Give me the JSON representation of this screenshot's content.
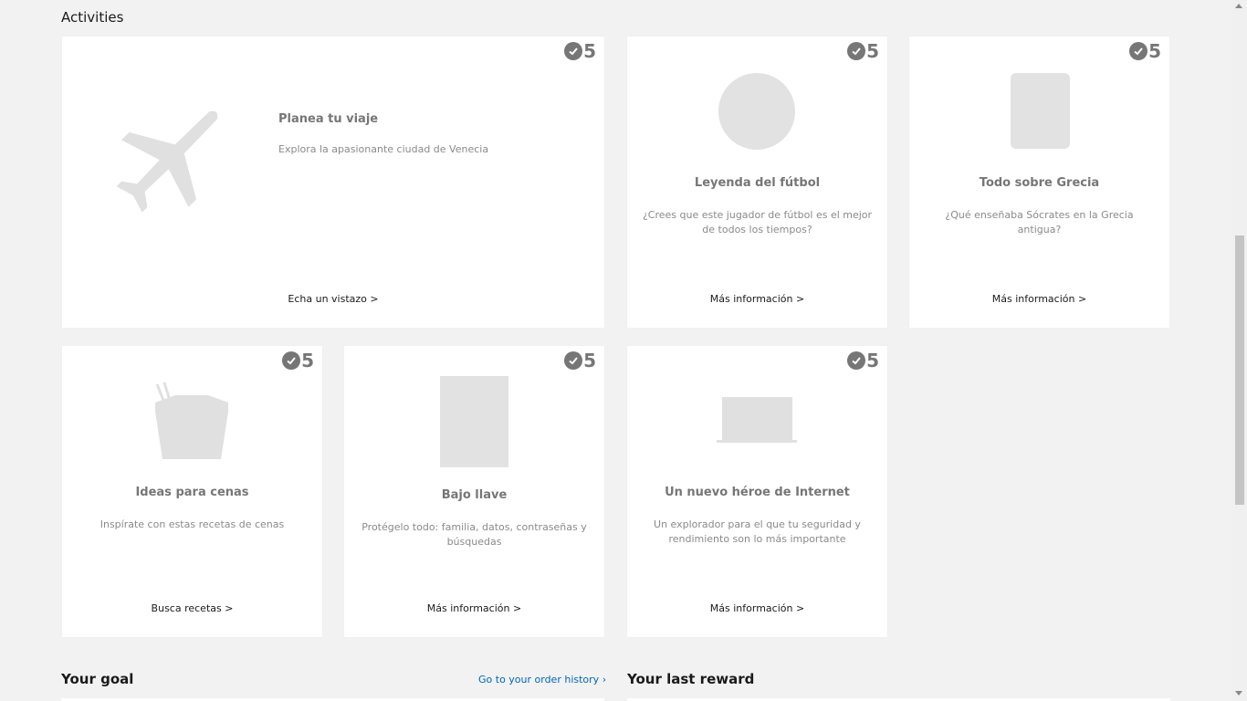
{
  "sections": {
    "activities": "Activities",
    "your_goal": "Your goal",
    "your_last_reward": "Your last reward",
    "order_history_link": "Go to your order history"
  },
  "cards": [
    {
      "id": "travel",
      "icon": "airplane-icon",
      "points": "5",
      "title": "Planea tu viaje",
      "desc": "Explora la apasionante ciudad de Venecia",
      "link": "Echa un vistazo >"
    },
    {
      "id": "football",
      "icon": "circle-placeholder-icon",
      "points": "5",
      "title": "Leyenda del fútbol",
      "desc": "¿Crees que este jugador de fútbol es el mejor de todos los tiempos?",
      "link": "Más información >"
    },
    {
      "id": "greece",
      "icon": "rounded-rect-placeholder-icon",
      "points": "5",
      "title": "Todo sobre Grecia",
      "desc": "¿Qué enseñaba Sócrates en la Grecia antigua?",
      "link": "Más información >"
    },
    {
      "id": "dinner",
      "icon": "takeout-box-icon",
      "points": "5",
      "title": "Ideas para cenas",
      "desc": "Inspírate con estas recetas de cenas",
      "link": "Busca recetas >"
    },
    {
      "id": "lock",
      "icon": "rect-placeholder-icon",
      "points": "5",
      "title": "Bajo llave",
      "desc": "Protégelo todo: familia, datos, contraseñas y búsquedas",
      "link": "Más información >"
    },
    {
      "id": "browser",
      "icon": "laptop-icon",
      "points": "5",
      "title": "Un nuevo héroe de Internet",
      "desc": "Un explorador para el que tu seguridad y rendimiento son lo más importante",
      "link": "Más información >"
    }
  ],
  "colors": {
    "background": "#f2f2f2",
    "card": "#ffffff",
    "muted": "#767676",
    "placeholder": "#e2e2e2",
    "link_blue": "#0067b8"
  }
}
